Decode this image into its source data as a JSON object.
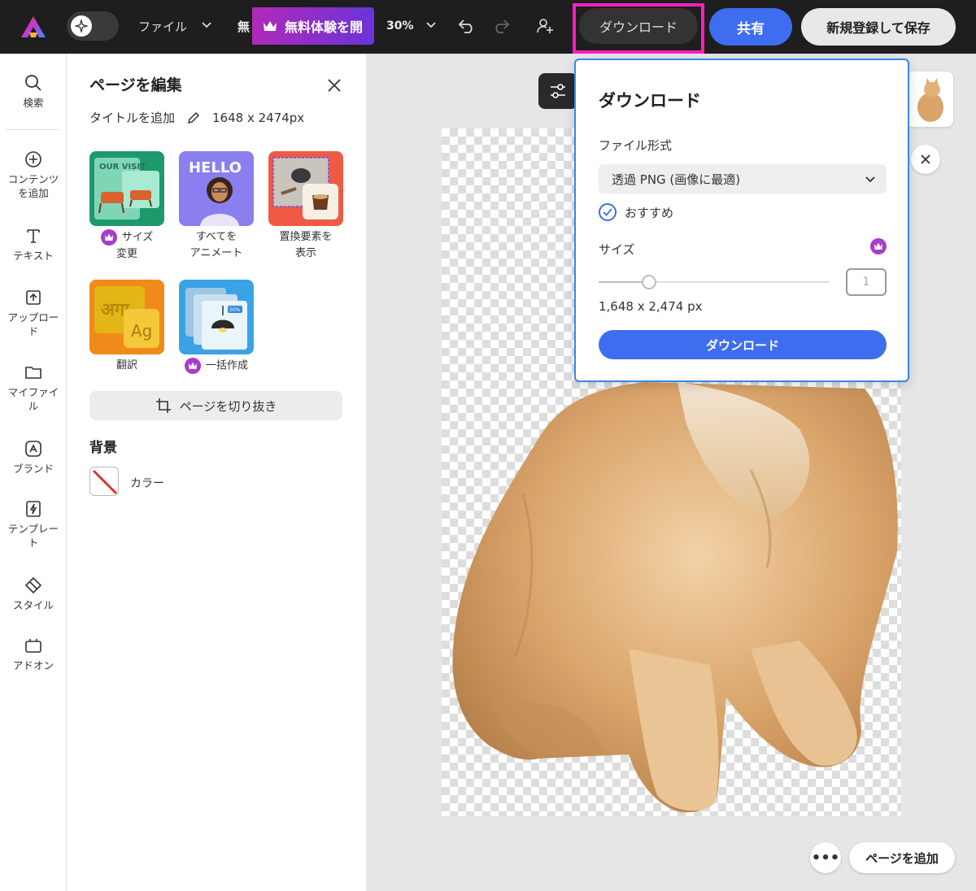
{
  "topbar": {
    "file_menu": "ファイル",
    "truncated_text": "無",
    "trial_label": "無料体験を開",
    "zoom": "30%",
    "download_label": "ダウンロード",
    "share_label": "共有",
    "signup_label": "新規登録して保存"
  },
  "rail": {
    "items": [
      {
        "label": "検索",
        "icon": "search-icon"
      },
      {
        "label": "コンテンツを追加",
        "icon": "plus-circle-icon"
      },
      {
        "label": "テキスト",
        "icon": "text-icon"
      },
      {
        "label": "アップロード",
        "icon": "upload-icon"
      },
      {
        "label": "マイファイル",
        "icon": "folder-icon"
      },
      {
        "label": "ブランド",
        "icon": "brand-icon"
      },
      {
        "label": "テンプレート",
        "icon": "template-icon"
      },
      {
        "label": "スタイル",
        "icon": "style-icon"
      },
      {
        "label": "アドオン",
        "icon": "addon-icon"
      }
    ]
  },
  "panel": {
    "title": "ページを編集",
    "add_title": "タイトルを追加",
    "dimensions": "1648 x 2474px",
    "tiles": [
      {
        "label1": "サイズ",
        "label2": "変更",
        "premium": true
      },
      {
        "label1": "すべてを",
        "label2": "アニメート",
        "premium": false
      },
      {
        "label1": "置換要素を",
        "label2": "表示",
        "premium": false
      },
      {
        "label1": "翻訳",
        "label2": "",
        "premium": false
      },
      {
        "label1": "一括作成",
        "label2": "",
        "premium": true
      }
    ],
    "tile_texts": {
      "our_visit": "OUR VISIT",
      "hello": "HELLO",
      "hindi": "अगा",
      "ag": "Ag",
      "badge": "50%"
    },
    "crop_label": "ページを切り抜き",
    "background_title": "背景",
    "color_label": "カラー"
  },
  "canvas": {
    "more_label": "•••",
    "add_page_label": "ページを追加"
  },
  "download_popover": {
    "title": "ダウンロード",
    "file_format_label": "ファイル形式",
    "file_format_value": "透過 PNG (画像に最適)",
    "recommended_label": "おすすめ",
    "size_label": "サイズ",
    "size_value": "1",
    "size_slider_fraction": 0.22,
    "dimensions": "1,648 x 2,474 px",
    "download_button": "ダウンロード"
  },
  "colors": {
    "accent_blue": "#3e6df0",
    "highlight_pink": "#ff1fbd",
    "premium_purple": "#a83dc8",
    "topbar_bg": "#1e1e1e"
  }
}
